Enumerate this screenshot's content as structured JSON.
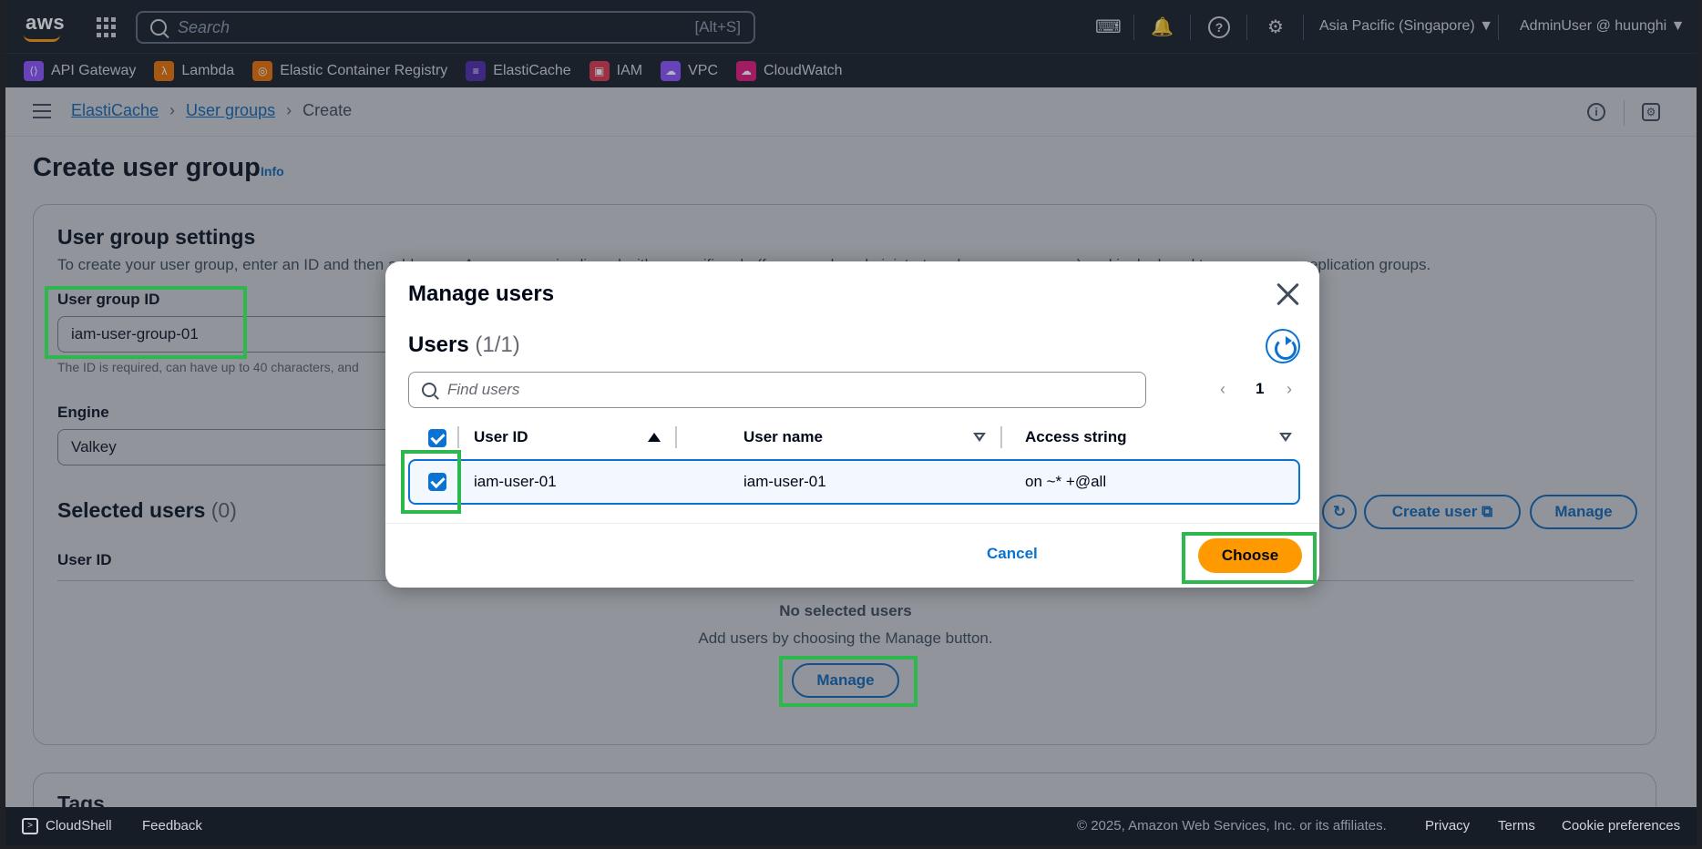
{
  "topnav": {
    "logo": "aws",
    "search_placeholder": "Search",
    "search_shortcut": "[Alt+S]",
    "region": "Asia Pacific (Singapore) ▼",
    "account": "AdminUser @ huunghi ▼",
    "icons": [
      "cloudshell-icon",
      "bell-icon",
      "help-icon",
      "gear-icon"
    ]
  },
  "favorites": [
    {
      "label": "API Gateway",
      "color": "#8c4fff"
    },
    {
      "label": "Lambda",
      "color": "#ed7100"
    },
    {
      "label": "Elastic Container Registry",
      "color": "#ed7100"
    },
    {
      "label": "ElastiCache",
      "color": "#4d27aa"
    },
    {
      "label": "IAM",
      "color": "#dd344c"
    },
    {
      "label": "VPC",
      "color": "#8c4fff"
    },
    {
      "label": "CloudWatch",
      "color": "#e7157b"
    }
  ],
  "breadcrumb": {
    "items": [
      "ElastiCache",
      "User groups"
    ],
    "current": "Create"
  },
  "page": {
    "title": "Create user group",
    "info": "Info",
    "settings": {
      "heading": "User group settings",
      "description": "To create your user group, enter an ID and then add users. A user group is aligned with a specific role (for example, administrators, human resources) and is deployed to one or more replication groups.",
      "id_label": "User group ID",
      "id_value": "iam-user-group-01",
      "id_hint": "The ID is required, can have up to 40 characters, and",
      "engine_label": "Engine",
      "engine_value": "Valkey"
    },
    "selected": {
      "heading": "Selected users",
      "count": "(0)",
      "create_user": "Create user",
      "manage": "Manage",
      "col_user_id": "User ID",
      "empty_title": "No selected users",
      "empty_desc": "Add users by choosing the Manage button.",
      "empty_manage": "Manage"
    },
    "tags_heading": "Tags"
  },
  "modal": {
    "title": "Manage users",
    "users_heading": "Users",
    "users_count": "(1/1)",
    "search_placeholder": "Find users",
    "page": "1",
    "columns": [
      "User ID",
      "User name",
      "Access string"
    ],
    "rows": [
      {
        "user_id": "iam-user-01",
        "user_name": "iam-user-01",
        "access_string": "on ~* +@all",
        "selected": true
      }
    ],
    "cancel": "Cancel",
    "choose": "Choose"
  },
  "footer": {
    "cloudshell": "CloudShell",
    "feedback": "Feedback",
    "copyright": "© 2025, Amazon Web Services, Inc. or its affiliates.",
    "privacy": "Privacy",
    "terms": "Terms",
    "cookies": "Cookie preferences"
  },
  "colors": {
    "accent": "#0972d3",
    "primary_button": "#ff9900",
    "highlight": "#2db84d",
    "nav_bg": "#161d26"
  }
}
